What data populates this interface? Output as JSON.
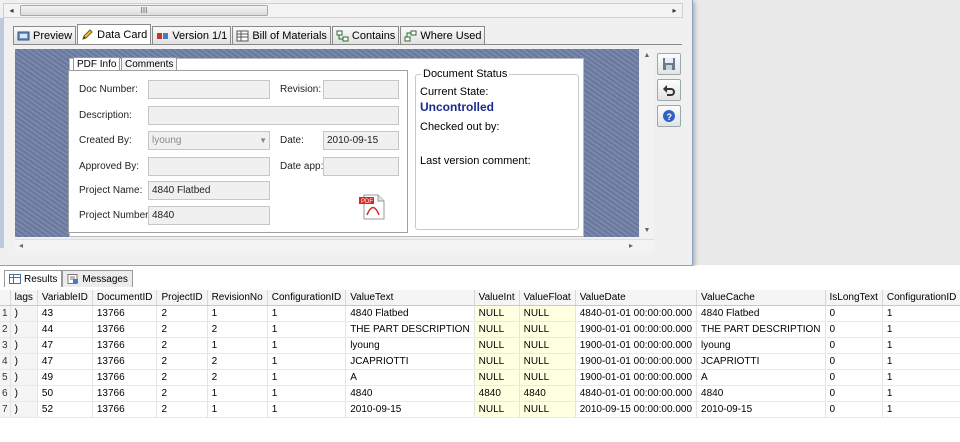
{
  "hscroll": {
    "left_arrow": "◂",
    "grip": "III",
    "right_arrow": "▸"
  },
  "tabs": [
    {
      "label": "Preview",
      "icon": "preview-icon"
    },
    {
      "label": "Data Card",
      "icon": "pencil-icon"
    },
    {
      "label": "Version 1/1",
      "icon": "version-icon"
    },
    {
      "label": "Bill of Materials",
      "icon": "table-icon"
    },
    {
      "label": "Contains",
      "icon": "contains-icon"
    },
    {
      "label": "Where Used",
      "icon": "where-used-icon"
    }
  ],
  "card": {
    "subtabs": [
      "PDF Info",
      "Comments"
    ],
    "labels": {
      "doc_number": "Doc Number:",
      "revision": "Revision:",
      "description": "Description:",
      "created_by": "Created By:",
      "date": "Date:",
      "approved_by": "Approved By:",
      "date_app": "Date app:",
      "project_name": "Project Name:",
      "project_number": "Project Number:"
    },
    "values": {
      "doc_number": "",
      "revision": "",
      "description": "",
      "created_by": "lyoung",
      "date": "2010-09-15",
      "approved_by": "",
      "date_app": "",
      "project_name": "4840 Flatbed",
      "project_number": "4840"
    },
    "pdf_icon_label": "PDF"
  },
  "status": {
    "legend": "Document Status",
    "current_state_label": "Current State:",
    "current_state": "Uncontrolled",
    "checked_out_label": "Checked out by:",
    "last_comment_label": "Last version comment:"
  },
  "results": {
    "tabs": [
      "Results",
      "Messages"
    ],
    "columns": [
      "lags",
      "VariableID",
      "DocumentID",
      "ProjectID",
      "RevisionNo",
      "ConfigurationID",
      "ValueText",
      "ValueInt",
      "ValueFloat",
      "ValueDate",
      "ValueCache",
      "IsLongText",
      "ConfigurationID"
    ],
    "rows": [
      [
        "1",
        ")",
        "43",
        "13766",
        "2",
        "1",
        "1",
        "4840 Flatbed",
        "NULL",
        "NULL",
        "4840-01-01 00:00:00.000",
        "4840 Flatbed",
        "0",
        "1"
      ],
      [
        "2",
        ")",
        "44",
        "13766",
        "2",
        "2",
        "1",
        "THE PART DESCRIPTION",
        "NULL",
        "NULL",
        "1900-01-01 00:00:00.000",
        "THE PART DESCRIPTION",
        "0",
        "1"
      ],
      [
        "3",
        ")",
        "47",
        "13766",
        "2",
        "1",
        "1",
        "lyoung",
        "NULL",
        "NULL",
        "1900-01-01 00:00:00.000",
        "lyoung",
        "0",
        "1"
      ],
      [
        "4",
        ")",
        "47",
        "13766",
        "2",
        "2",
        "1",
        "JCAPRIOTTI",
        "NULL",
        "NULL",
        "1900-01-01 00:00:00.000",
        "JCAPRIOTTI",
        "0",
        "1"
      ],
      [
        "5",
        ")",
        "49",
        "13766",
        "2",
        "2",
        "1",
        "A",
        "NULL",
        "NULL",
        "1900-01-01 00:00:00.000",
        "A",
        "0",
        "1"
      ],
      [
        "6",
        ")",
        "50",
        "13766",
        "2",
        "1",
        "1",
        "4840",
        "4840",
        "4840",
        "4840-01-01 00:00:00.000",
        "4840",
        "0",
        "1"
      ],
      [
        "7",
        ")",
        "52",
        "13766",
        "2",
        "1",
        "1",
        "2010-09-15",
        "NULL",
        "NULL",
        "2010-09-15 00:00:00.000",
        "2010-09-15",
        "0",
        "1"
      ]
    ]
  },
  "colors": {
    "state": "#1a2a8a",
    "null_cell": "#ffffe1",
    "panel": "#6e7fa6"
  }
}
